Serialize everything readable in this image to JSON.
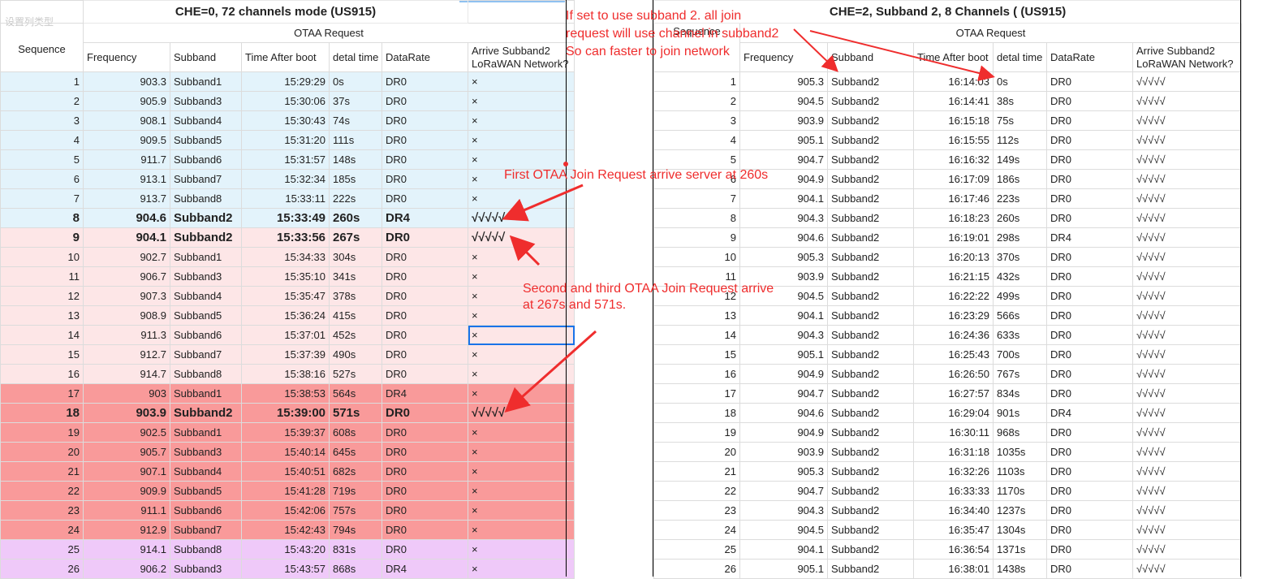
{
  "faded_toolbar_text": "设置列类型",
  "left": {
    "title": "CHE=0, 72 channels mode    (US915)",
    "subheader": "OTAA Request",
    "columns": [
      "Sequence",
      "Frequency",
      "Subband",
      "Time After boot",
      "detal time",
      "DataRate",
      "Arrive Subband2 LoRaWAN Network?"
    ],
    "rows": [
      {
        "seq": "1",
        "freq": "903.3",
        "sub": "Subband1",
        "time": "15:29:29",
        "delta": "0s",
        "dr": "DR0",
        "arrive": "×"
      },
      {
        "seq": "2",
        "freq": "905.9",
        "sub": "Subband3",
        "time": "15:30:06",
        "delta": "37s",
        "dr": "DR0",
        "arrive": "×"
      },
      {
        "seq": "3",
        "freq": "908.1",
        "sub": "Subband4",
        "time": "15:30:43",
        "delta": "74s",
        "dr": "DR0",
        "arrive": "×"
      },
      {
        "seq": "4",
        "freq": "909.5",
        "sub": "Subband5",
        "time": "15:31:20",
        "delta": "111s",
        "dr": "DR0",
        "arrive": "×"
      },
      {
        "seq": "5",
        "freq": "911.7",
        "sub": "Subband6",
        "time": "15:31:57",
        "delta": "148s",
        "dr": "DR0",
        "arrive": "×"
      },
      {
        "seq": "6",
        "freq": "913.1",
        "sub": "Subband7",
        "time": "15:32:34",
        "delta": "185s",
        "dr": "DR0",
        "arrive": "×"
      },
      {
        "seq": "7",
        "freq": "913.7",
        "sub": "Subband8",
        "time": "15:33:11",
        "delta": "222s",
        "dr": "DR0",
        "arrive": "×"
      },
      {
        "seq": "8",
        "freq": "904.6",
        "sub": "Subband2",
        "time": "15:33:49",
        "delta": "260s",
        "dr": "DR4",
        "arrive": "√√√√√"
      },
      {
        "seq": "9",
        "freq": "904.1",
        "sub": "Subband2",
        "time": "15:33:56",
        "delta": "267s",
        "dr": "DR0",
        "arrive": "√√√√√"
      },
      {
        "seq": "10",
        "freq": "902.7",
        "sub": "Subband1",
        "time": "15:34:33",
        "delta": "304s",
        "dr": "DR0",
        "arrive": "×"
      },
      {
        "seq": "11",
        "freq": "906.7",
        "sub": "Subband3",
        "time": "15:35:10",
        "delta": "341s",
        "dr": "DR0",
        "arrive": "×"
      },
      {
        "seq": "12",
        "freq": "907.3",
        "sub": "Subband4",
        "time": "15:35:47",
        "delta": "378s",
        "dr": "DR0",
        "arrive": "×"
      },
      {
        "seq": "13",
        "freq": "908.9",
        "sub": "Subband5",
        "time": "15:36:24",
        "delta": "415s",
        "dr": "DR0",
        "arrive": "×"
      },
      {
        "seq": "14",
        "freq": "911.3",
        "sub": "Subband6",
        "time": "15:37:01",
        "delta": "452s",
        "dr": "DR0",
        "arrive": "×"
      },
      {
        "seq": "15",
        "freq": "912.7",
        "sub": "Subband7",
        "time": "15:37:39",
        "delta": "490s",
        "dr": "DR0",
        "arrive": "×"
      },
      {
        "seq": "16",
        "freq": "914.7",
        "sub": "Subband8",
        "time": "15:38:16",
        "delta": "527s",
        "dr": "DR0",
        "arrive": "×"
      },
      {
        "seq": "17",
        "freq": "903",
        "sub": "Subband1",
        "time": "15:38:53",
        "delta": "564s",
        "dr": "DR4",
        "arrive": "×"
      },
      {
        "seq": "18",
        "freq": "903.9",
        "sub": "Subband2",
        "time": "15:39:00",
        "delta": "571s",
        "dr": "DR0",
        "arrive": "√√√√√"
      },
      {
        "seq": "19",
        "freq": "902.5",
        "sub": "Subband1",
        "time": "15:39:37",
        "delta": "608s",
        "dr": "DR0",
        "arrive": "×"
      },
      {
        "seq": "20",
        "freq": "905.7",
        "sub": "Subband3",
        "time": "15:40:14",
        "delta": "645s",
        "dr": "DR0",
        "arrive": "×"
      },
      {
        "seq": "21",
        "freq": "907.1",
        "sub": "Subband4",
        "time": "15:40:51",
        "delta": "682s",
        "dr": "DR0",
        "arrive": "×"
      },
      {
        "seq": "22",
        "freq": "909.9",
        "sub": "Subband5",
        "time": "15:41:28",
        "delta": "719s",
        "dr": "DR0",
        "arrive": "×"
      },
      {
        "seq": "23",
        "freq": "911.1",
        "sub": "Subband6",
        "time": "15:42:06",
        "delta": "757s",
        "dr": "DR0",
        "arrive": "×"
      },
      {
        "seq": "24",
        "freq": "912.9",
        "sub": "Subband7",
        "time": "15:42:43",
        "delta": "794s",
        "dr": "DR0",
        "arrive": "×"
      },
      {
        "seq": "25",
        "freq": "914.1",
        "sub": "Subband8",
        "time": "15:43:20",
        "delta": "831s",
        "dr": "DR0",
        "arrive": "×"
      },
      {
        "seq": "26",
        "freq": "906.2",
        "sub": "Subband3",
        "time": "15:43:57",
        "delta": "868s",
        "dr": "DR4",
        "arrive": "×"
      }
    ]
  },
  "right": {
    "title": "CHE=2, Subband 2, 8 Channels  (  (US915)",
    "subheader": "OTAA Request",
    "columns": [
      "Sequence",
      "Frequency",
      "Subband",
      "Time After boot",
      "detal time",
      "DataRate",
      "Arrive Subband2 LoRaWAN Network?"
    ],
    "rows": [
      {
        "seq": "1",
        "freq": "905.3",
        "sub": "Subband2",
        "time": "16:14:03",
        "delta": "0s",
        "dr": "DR0",
        "arrive": "√√√√√"
      },
      {
        "seq": "2",
        "freq": "904.5",
        "sub": "Subband2",
        "time": "16:14:41",
        "delta": "38s",
        "dr": "DR0",
        "arrive": "√√√√√"
      },
      {
        "seq": "3",
        "freq": "903.9",
        "sub": "Subband2",
        "time": "16:15:18",
        "delta": "75s",
        "dr": "DR0",
        "arrive": "√√√√√"
      },
      {
        "seq": "4",
        "freq": "905.1",
        "sub": "Subband2",
        "time": "16:15:55",
        "delta": "112s",
        "dr": "DR0",
        "arrive": "√√√√√"
      },
      {
        "seq": "5",
        "freq": "904.7",
        "sub": "Subband2",
        "time": "16:16:32",
        "delta": "149s",
        "dr": "DR0",
        "arrive": "√√√√√"
      },
      {
        "seq": "6",
        "freq": "904.9",
        "sub": "Subband2",
        "time": "16:17:09",
        "delta": "186s",
        "dr": "DR0",
        "arrive": "√√√√√"
      },
      {
        "seq": "7",
        "freq": "904.1",
        "sub": "Subband2",
        "time": "16:17:46",
        "delta": "223s",
        "dr": "DR0",
        "arrive": "√√√√√"
      },
      {
        "seq": "8",
        "freq": "904.3",
        "sub": "Subband2",
        "time": "16:18:23",
        "delta": "260s",
        "dr": "DR0",
        "arrive": "√√√√√"
      },
      {
        "seq": "9",
        "freq": "904.6",
        "sub": "Subband2",
        "time": "16:19:01",
        "delta": "298s",
        "dr": "DR4",
        "arrive": "√√√√√"
      },
      {
        "seq": "10",
        "freq": "905.3",
        "sub": "Subband2",
        "time": "16:20:13",
        "delta": "370s",
        "dr": "DR0",
        "arrive": "√√√√√"
      },
      {
        "seq": "11",
        "freq": "903.9",
        "sub": "Subband2",
        "time": "16:21:15",
        "delta": "432s",
        "dr": "DR0",
        "arrive": "√√√√√"
      },
      {
        "seq": "12",
        "freq": "904.5",
        "sub": "Subband2",
        "time": "16:22:22",
        "delta": "499s",
        "dr": "DR0",
        "arrive": "√√√√√"
      },
      {
        "seq": "13",
        "freq": "904.1",
        "sub": "Subband2",
        "time": "16:23:29",
        "delta": "566s",
        "dr": "DR0",
        "arrive": "√√√√√"
      },
      {
        "seq": "14",
        "freq": "904.3",
        "sub": "Subband2",
        "time": "16:24:36",
        "delta": "633s",
        "dr": "DR0",
        "arrive": "√√√√√"
      },
      {
        "seq": "15",
        "freq": "905.1",
        "sub": "Subband2",
        "time": "16:25:43",
        "delta": "700s",
        "dr": "DR0",
        "arrive": "√√√√√"
      },
      {
        "seq": "16",
        "freq": "904.9",
        "sub": "Subband2",
        "time": "16:26:50",
        "delta": "767s",
        "dr": "DR0",
        "arrive": "√√√√√"
      },
      {
        "seq": "17",
        "freq": "904.7",
        "sub": "Subband2",
        "time": "16:27:57",
        "delta": "834s",
        "dr": "DR0",
        "arrive": "√√√√√"
      },
      {
        "seq": "18",
        "freq": "904.6",
        "sub": "Subband2",
        "time": "16:29:04",
        "delta": "901s",
        "dr": "DR4",
        "arrive": "√√√√√"
      },
      {
        "seq": "19",
        "freq": "904.9",
        "sub": "Subband2",
        "time": "16:30:11",
        "delta": "968s",
        "dr": "DR0",
        "arrive": "√√√√√"
      },
      {
        "seq": "20",
        "freq": "903.9",
        "sub": "Subband2",
        "time": "16:31:18",
        "delta": "1035s",
        "dr": "DR0",
        "arrive": "√√√√√"
      },
      {
        "seq": "21",
        "freq": "905.3",
        "sub": "Subband2",
        "time": "16:32:26",
        "delta": "1103s",
        "dr": "DR0",
        "arrive": "√√√√√"
      },
      {
        "seq": "22",
        "freq": "904.7",
        "sub": "Subband2",
        "time": "16:33:33",
        "delta": "1170s",
        "dr": "DR0",
        "arrive": "√√√√√"
      },
      {
        "seq": "23",
        "freq": "904.3",
        "sub": "Subband2",
        "time": "16:34:40",
        "delta": "1237s",
        "dr": "DR0",
        "arrive": "√√√√√"
      },
      {
        "seq": "24",
        "freq": "904.5",
        "sub": "Subband2",
        "time": "16:35:47",
        "delta": "1304s",
        "dr": "DR0",
        "arrive": "√√√√√"
      },
      {
        "seq": "25",
        "freq": "904.1",
        "sub": "Subband2",
        "time": "16:36:54",
        "delta": "1371s",
        "dr": "DR0",
        "arrive": "√√√√√"
      },
      {
        "seq": "26",
        "freq": "905.1",
        "sub": "Subband2",
        "time": "16:38:01",
        "delta": "1438s",
        "dr": "DR0",
        "arrive": "√√√√√"
      }
    ]
  },
  "annotations": {
    "subband_note": [
      "If set to use subband 2. all join",
      "request will use channel in subband2",
      "So can faster to join network"
    ],
    "first_join": "First OTAA Join Request arrive server at 260s",
    "second_third": [
      "Second and third OTAA Join Request arrive",
      "at 267s and 571s."
    ]
  },
  "colors": {
    "blue_rows": "#e3f3fb",
    "pink_rows": "#fde6e7",
    "red_rows": "#f99a9a",
    "purple_rows": "#efc9f9",
    "annotation": "#ef2d2d",
    "selection": "#1a73e8"
  }
}
